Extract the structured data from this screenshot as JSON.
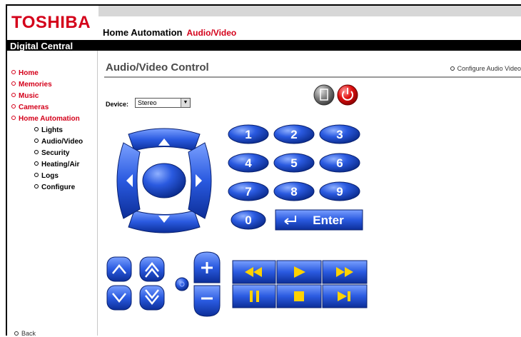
{
  "brand": {
    "logo": "TOSHIBA",
    "name": "Digital Central"
  },
  "topnav": {
    "home_automation": "Home Automation",
    "active": "Audio/Video"
  },
  "sidebar": {
    "main": [
      "Home",
      "Memories",
      "Music",
      "Cameras",
      "Home Automation"
    ],
    "sub": [
      "Lights",
      "Audio/Video",
      "Security",
      "Heating/Air",
      "Logs",
      "Configure"
    ]
  },
  "content": {
    "title": "Audio/Video Control",
    "configure_link": "Configure Audio Video",
    "device_label": "Device:",
    "device_value": "Stereo",
    "back": "Back"
  },
  "keypad": {
    "digits": [
      "1",
      "2",
      "3",
      "4",
      "5",
      "6",
      "7",
      "8",
      "9",
      "0"
    ],
    "enter": "Enter"
  },
  "colors": {
    "accent": "#d4001a",
    "button_blue": "#1b48c8",
    "power_red": "#e01010"
  },
  "icons": [
    "up-arrow-icon",
    "down-arrow-icon",
    "left-arrow-icon",
    "right-arrow-icon",
    "rewind-icon",
    "play-icon",
    "fast-forward-icon",
    "pause-icon",
    "stop-icon",
    "skip-icon",
    "power-icon",
    "menu-icon"
  ]
}
